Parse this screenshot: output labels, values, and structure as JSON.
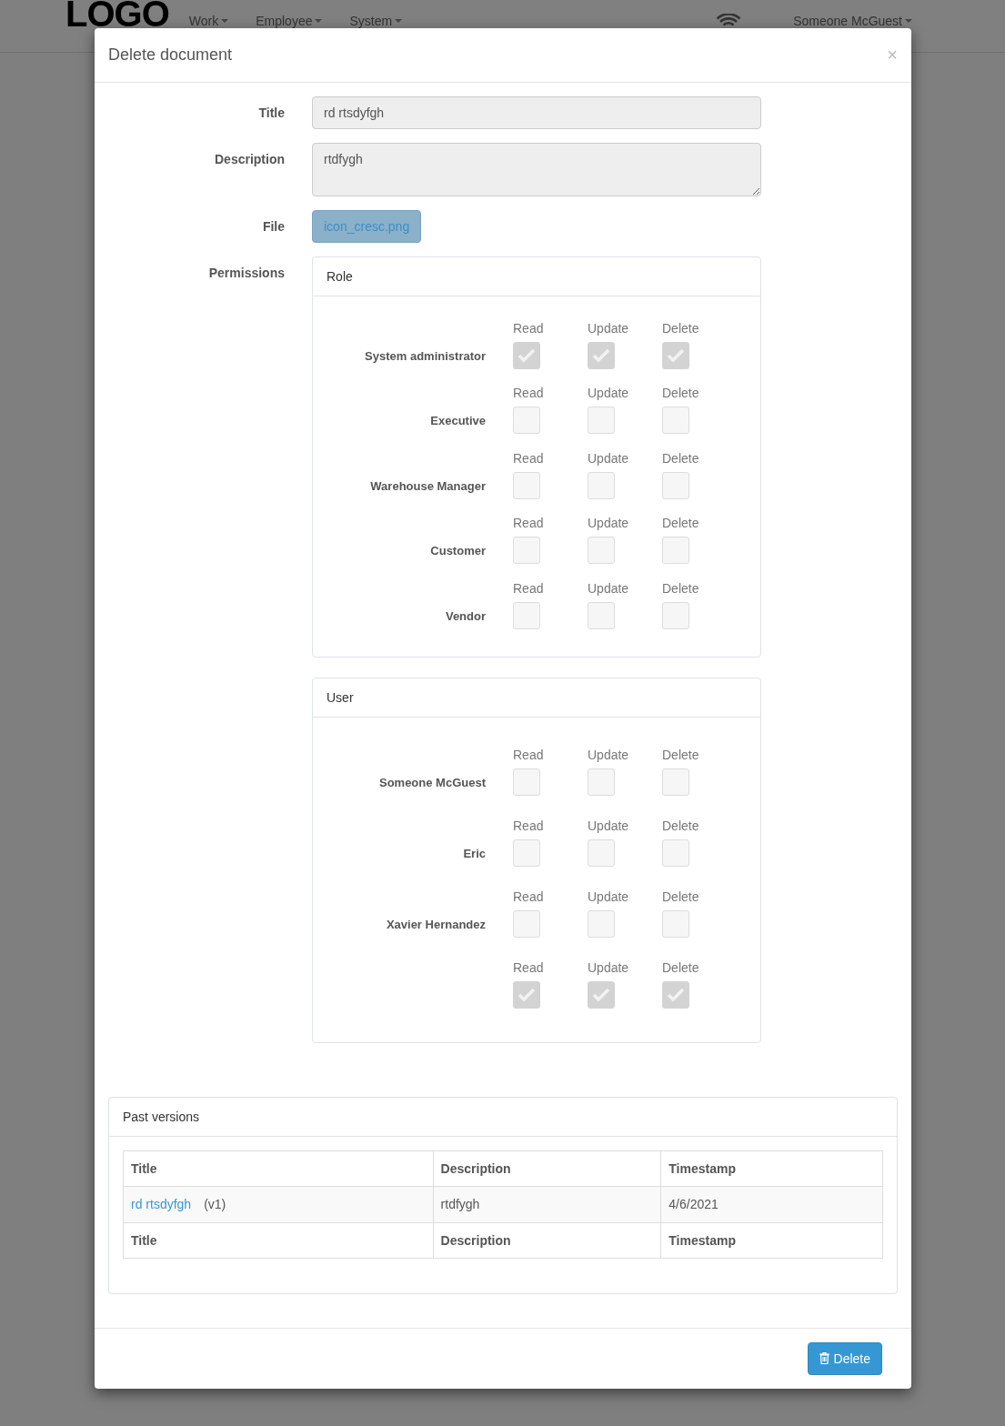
{
  "navbar": {
    "logo": "LOGO",
    "menus": [
      {
        "label": "Work"
      },
      {
        "label": "Employee"
      },
      {
        "label": "System"
      }
    ],
    "user": "Someone McGuest"
  },
  "modal": {
    "title": "Delete document",
    "close": "×",
    "fields": {
      "title_label": "Title",
      "title_value": "rd rtsdyfgh",
      "description_label": "Description",
      "description_value": "rtdfygh",
      "file_label": "File",
      "file_name": "icon_cresc.png",
      "permissions_label": "Permissions"
    },
    "permission_groups": [
      {
        "title": "Role",
        "entries": [
          {
            "name": "System administrator",
            "perms": [
              {
                "label": "Read",
                "checked": true
              },
              {
                "label": "Update",
                "checked": true
              },
              {
                "label": "Delete",
                "checked": true
              }
            ]
          },
          {
            "name": "Executive",
            "perms": [
              {
                "label": "Read",
                "checked": false
              },
              {
                "label": "Update",
                "checked": false
              },
              {
                "label": "Delete",
                "checked": false
              }
            ]
          },
          {
            "name": "Warehouse Manager",
            "perms": [
              {
                "label": "Read",
                "checked": false
              },
              {
                "label": "Update",
                "checked": false
              },
              {
                "label": "Delete",
                "checked": false
              }
            ]
          },
          {
            "name": "Customer",
            "perms": [
              {
                "label": "Read",
                "checked": false
              },
              {
                "label": "Update",
                "checked": false
              },
              {
                "label": "Delete",
                "checked": false
              }
            ]
          },
          {
            "name": "Vendor",
            "perms": [
              {
                "label": "Read",
                "checked": false
              },
              {
                "label": "Update",
                "checked": false
              },
              {
                "label": "Delete",
                "checked": false
              }
            ]
          }
        ]
      },
      {
        "title": "User",
        "entries": [
          {
            "name": "Someone McGuest",
            "perms": [
              {
                "label": "Read",
                "checked": false
              },
              {
                "label": "Update",
                "checked": false
              },
              {
                "label": "Delete",
                "checked": false
              }
            ]
          },
          {
            "name": "Eric",
            "perms": [
              {
                "label": "Read",
                "checked": false
              },
              {
                "label": "Update",
                "checked": false
              },
              {
                "label": "Delete",
                "checked": false
              }
            ]
          },
          {
            "name": "Xavier Hernandez",
            "perms": [
              {
                "label": "Read",
                "checked": false
              },
              {
                "label": "Update",
                "checked": false
              },
              {
                "label": "Delete",
                "checked": false
              }
            ]
          },
          {
            "perms": [
              {
                "label": "Read",
                "checked": true
              },
              {
                "label": "Update",
                "checked": true
              },
              {
                "label": "Delete",
                "checked": true
              }
            ]
          }
        ]
      }
    ],
    "past_versions": {
      "title": "Past versions",
      "columns": [
        "Title",
        "Description",
        "Timestamp"
      ],
      "rows": [
        {
          "title": "rd rtsdyfgh",
          "version": "(v1)",
          "description": "rtdfygh",
          "timestamp": "4/6/2021"
        }
      ],
      "footer": [
        "Title",
        "Description",
        "Timestamp"
      ]
    },
    "delete_button": "Delete"
  }
}
